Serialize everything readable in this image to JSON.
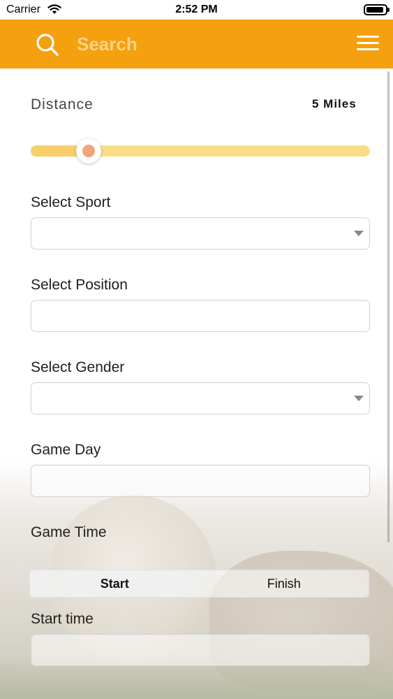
{
  "status_bar": {
    "carrier": "Carrier",
    "time": "2:52 PM"
  },
  "header": {
    "search_placeholder": "Search",
    "accent_color": "#f5a00f"
  },
  "filters": {
    "distance": {
      "label": "Distance",
      "value_text": "5 Miles",
      "slider_fraction": 0.17
    },
    "sport": {
      "label": "Select Sport",
      "value": ""
    },
    "position": {
      "label": "Select Position",
      "value": ""
    },
    "gender": {
      "label": "Select Gender",
      "value": ""
    },
    "game_day": {
      "label": "Game Day",
      "value": ""
    },
    "game_time": {
      "label": "Game Time",
      "segments": [
        {
          "label": "Start",
          "selected": true
        },
        {
          "label": "Finish",
          "selected": false
        }
      ]
    },
    "start_time": {
      "label": "Start time",
      "value": ""
    }
  },
  "icons": {
    "search": "search-icon",
    "menu": "hamburger-menu-icon",
    "dropdown": "chevron-down-icon",
    "wifi": "wifi-icon",
    "battery": "battery-icon"
  }
}
